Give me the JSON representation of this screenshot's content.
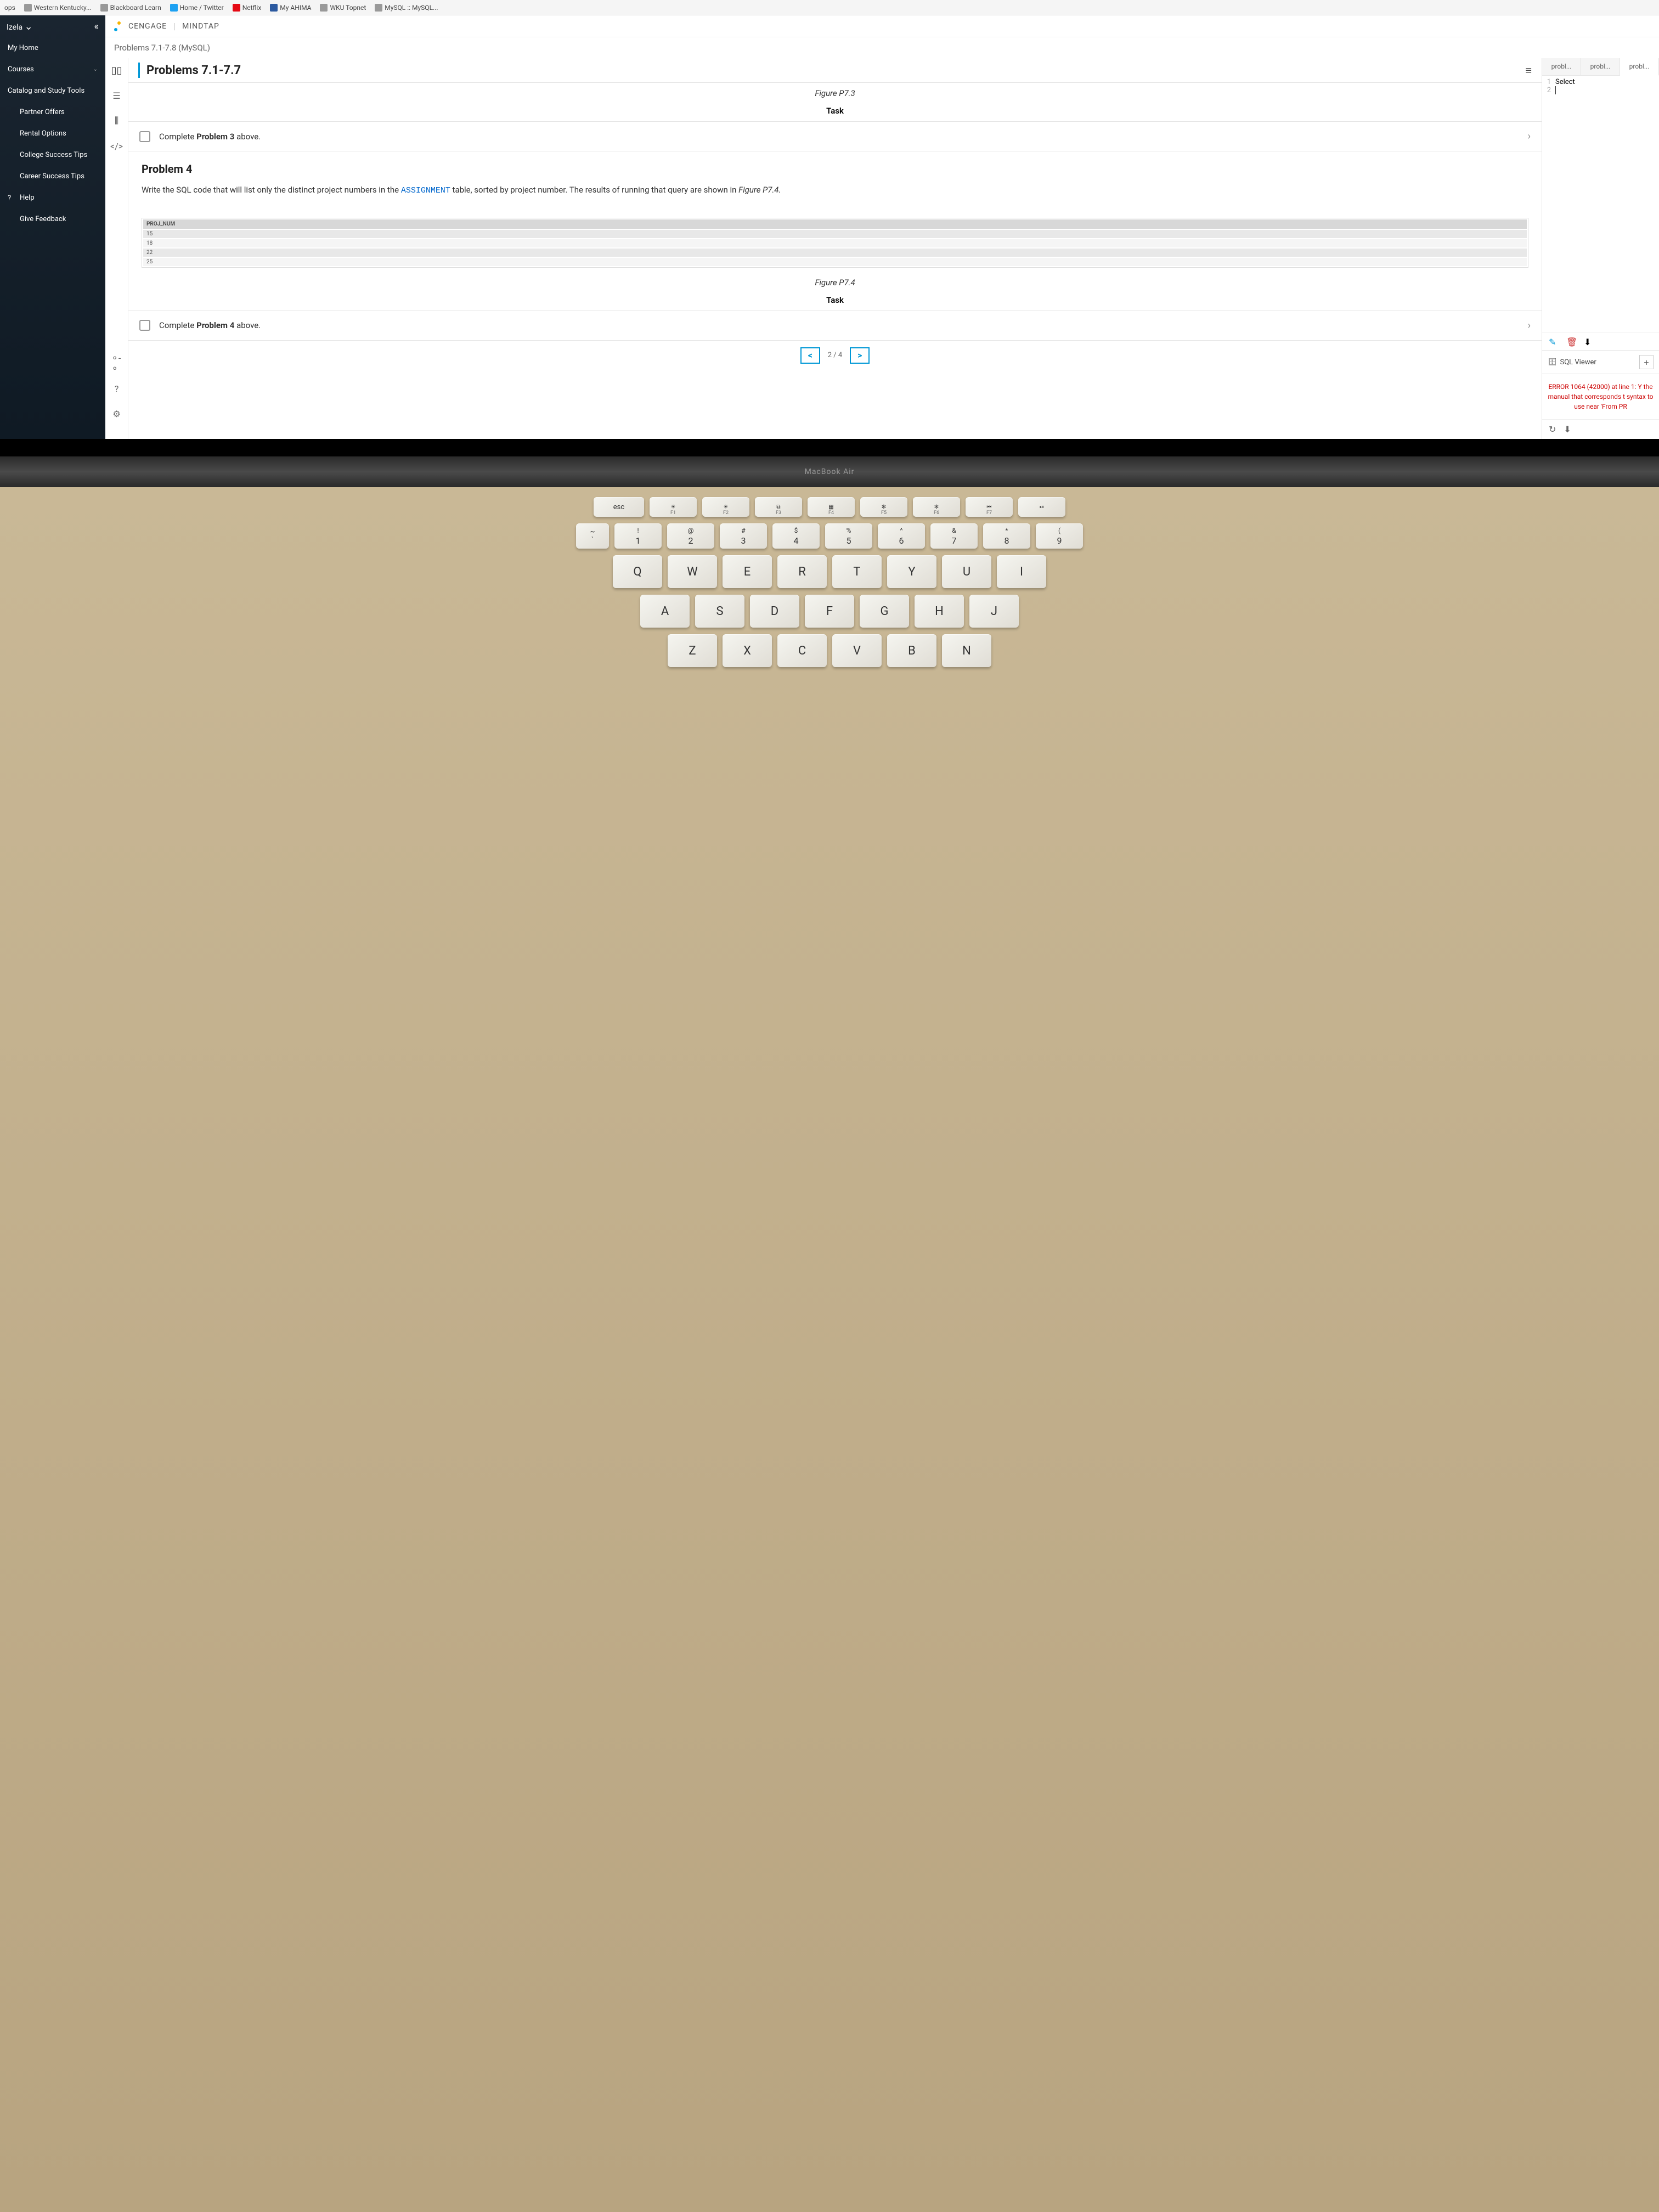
{
  "bookmarks": {
    "apps": "ops",
    "items": [
      {
        "label": "Western Kentucky..."
      },
      {
        "label": "Blackboard Learn"
      },
      {
        "label": "Home / Twitter"
      },
      {
        "label": "Netflix"
      },
      {
        "label": "My AHIMA"
      },
      {
        "label": "WKU Topnet"
      },
      {
        "label": "MySQL :: MySQL..."
      }
    ]
  },
  "sidebar": {
    "user": "Izela",
    "items": {
      "home": "My Home",
      "courses": "Courses",
      "catalog": "Catalog and Study Tools",
      "partner": "Partner Offers",
      "rental": "Rental Options",
      "college": "College Success Tips",
      "career": "Career Success Tips",
      "help": "Help",
      "feedback": "Give Feedback"
    }
  },
  "brand": {
    "cengage": "CENGAGE",
    "mindtap": "MINDTAP"
  },
  "breadcrumb": "Problems 7.1-7.8 (MySQL)",
  "content": {
    "title": "Problems 7.1-7.7",
    "figure73": "Figure P7.3",
    "task_label": "Task",
    "task3_pre": "Complete ",
    "task3_bold": "Problem 3",
    "task3_post": " above.",
    "problem4": {
      "heading": "Problem 4",
      "text_pre": "Write the SQL code that will list only the distinct project numbers in the ",
      "code": "ASSIGNMENT",
      "text_mid": " table, sorted by project number. The results of running that query are shown in ",
      "figure_ref": "Figure P7.4."
    },
    "result_table": {
      "header": "PROJ_NUM",
      "rows": [
        "15",
        "18",
        "22",
        "25"
      ]
    },
    "figure74": "Figure P7.4",
    "task4_pre": "Complete ",
    "task4_bold": "Problem 4",
    "task4_post": " above.",
    "pagination": {
      "prev": "<",
      "info": "2 / 4",
      "next": ">"
    }
  },
  "right": {
    "tabs": [
      "probl...",
      "probl...",
      "probl..."
    ],
    "code": {
      "line1_num": "1",
      "line1_text": "Select",
      "line2_num": "2",
      "line2_text": ""
    },
    "viewer_title": "SQL Viewer",
    "error": "ERROR 1064 (42000) at line 1: Y the manual that corresponds t syntax to use near 'From PR"
  },
  "laptop": {
    "brand": "MacBook Air"
  },
  "keyboard": {
    "fn_row": [
      {
        "main": "esc",
        "sub": ""
      },
      {
        "main": "☀",
        "sub": "F1"
      },
      {
        "main": "☀",
        "sub": "F2"
      },
      {
        "main": "⧉",
        "sub": "F3"
      },
      {
        "main": "▦",
        "sub": "F4"
      },
      {
        "main": "✻",
        "sub": "F5"
      },
      {
        "main": "✻",
        "sub": "F6"
      },
      {
        "main": "⏮",
        "sub": "F7"
      },
      {
        "main": "⏯",
        "sub": ""
      }
    ],
    "num_row": [
      {
        "sym": "~",
        "num": "`"
      },
      {
        "sym": "!",
        "num": "1"
      },
      {
        "sym": "@",
        "num": "2"
      },
      {
        "sym": "#",
        "num": "3"
      },
      {
        "sym": "$",
        "num": "4"
      },
      {
        "sym": "%",
        "num": "5"
      },
      {
        "sym": "^",
        "num": "6"
      },
      {
        "sym": "&",
        "num": "7"
      },
      {
        "sym": "*",
        "num": "8"
      },
      {
        "sym": "(",
        "num": "9"
      }
    ],
    "row_q": [
      "Q",
      "W",
      "E",
      "R",
      "T",
      "Y",
      "U",
      "I"
    ],
    "row_a": [
      "A",
      "S",
      "D",
      "F",
      "G",
      "H",
      "J"
    ],
    "row_z": [
      "Z",
      "X",
      "C",
      "V",
      "B",
      "N"
    ]
  }
}
